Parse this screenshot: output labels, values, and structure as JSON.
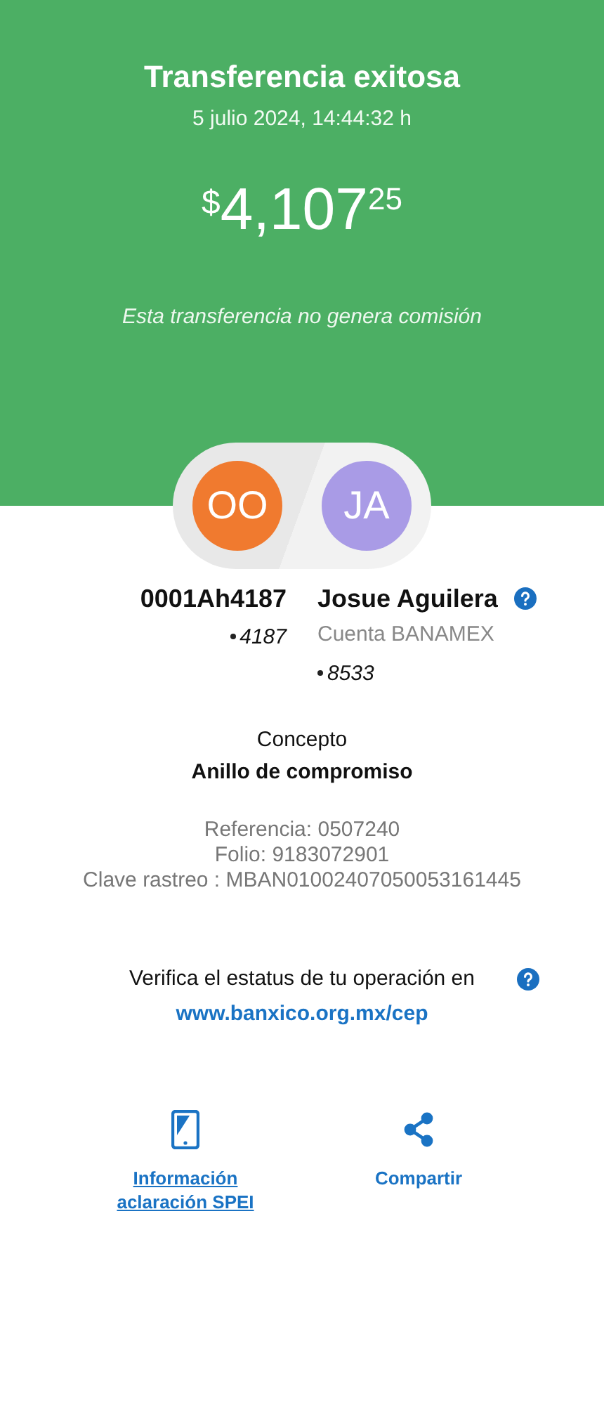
{
  "header": {
    "title": "Transferencia exitosa",
    "datetime": "5 julio 2024, 14:44:32 h",
    "amount": {
      "currency": "$",
      "integer": "4,107",
      "cents": "25"
    },
    "note": "Esta transferencia no genera comisión"
  },
  "parties": [
    {
      "initials": "OO",
      "color": "#f07a2f",
      "name": "0001Ah4187",
      "lines": [
        {
          "kind": "masked",
          "text": "4187"
        }
      ],
      "help": false
    },
    {
      "initials": "JA",
      "color": "#a99be6",
      "name": "Josue Aguilera",
      "lines": [
        {
          "kind": "bank",
          "text": "Cuenta BANAMEX"
        },
        {
          "kind": "masked",
          "text": "8533"
        }
      ],
      "help": true
    }
  ],
  "concept": {
    "label": "Concepto",
    "value": "Anillo de compromiso"
  },
  "details": [
    "Referencia: 0507240",
    "Folio: 9183072901",
    "Clave rastreo : MBAN01002407050053161445"
  ],
  "verify": {
    "text": "Verifica el estatus de tu operación en",
    "link": "www.banxico.org.mx/cep"
  },
  "actions": [
    {
      "kind": "phone",
      "label": "Información aclaración SPEI",
      "underlined": true
    },
    {
      "kind": "share",
      "label": "Compartir",
      "underlined": false
    }
  ]
}
